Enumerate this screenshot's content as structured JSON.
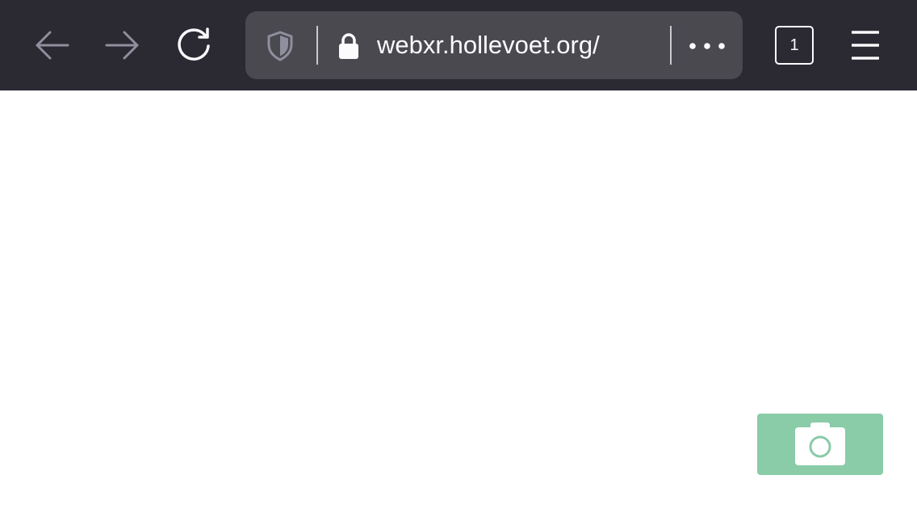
{
  "toolbar": {
    "background": "#2b2a33",
    "back": {
      "icon": "arrow-left-icon",
      "enabled": false
    },
    "forward": {
      "icon": "arrow-right-icon",
      "enabled": false
    },
    "reload": {
      "icon": "reload-icon"
    },
    "url_bar": {
      "background": "#4a4950",
      "tracking_protection_icon": "shield-icon",
      "security_icon": "lock-icon",
      "url": "webxr.hollevoet.org/",
      "page_actions_icon": "more-horizontal-icon"
    },
    "tabs": {
      "count": "1"
    },
    "menu": {
      "icon": "hamburger-menu-icon"
    }
  },
  "page": {
    "background": "#ffffff",
    "camera_button": {
      "icon": "camera-icon",
      "background": "#8acba8"
    }
  }
}
